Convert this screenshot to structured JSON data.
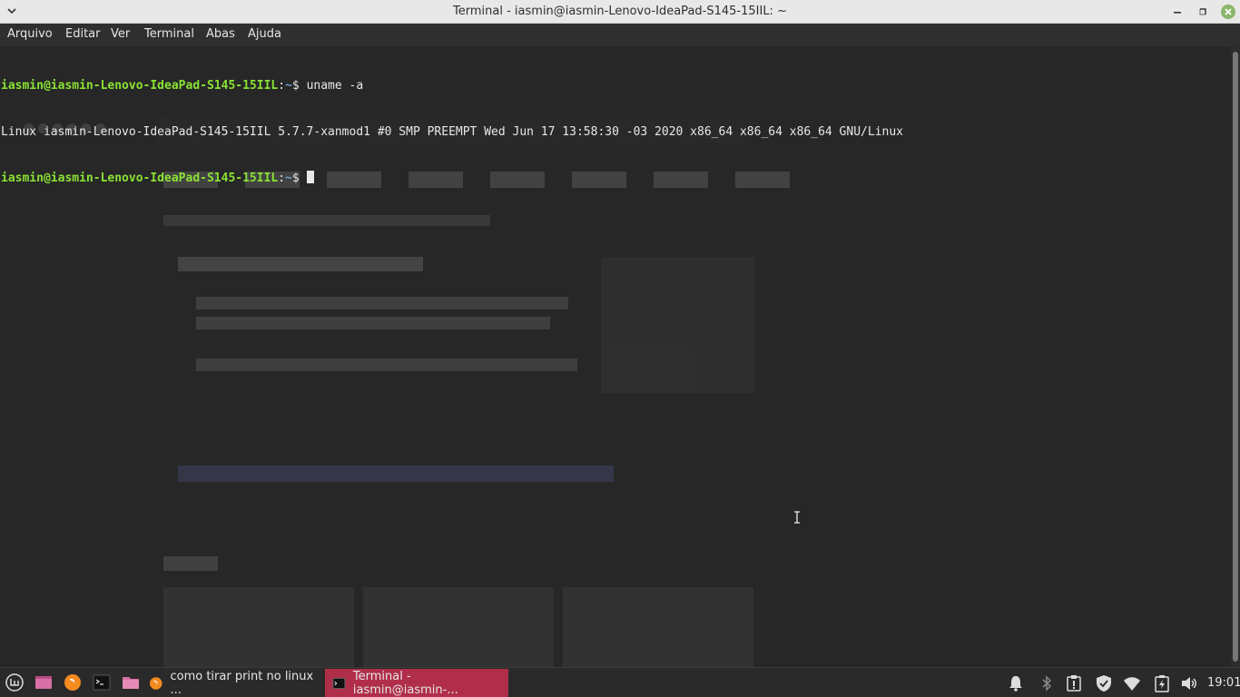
{
  "window": {
    "title": "Terminal - iasmin@iasmin-Lenovo-IdeaPad-S145-15IIL: ~"
  },
  "menu": [
    "Arquivo",
    "Editar",
    "Ver",
    "Terminal",
    "Abas",
    "Ajuda"
  ],
  "terminal": {
    "lines": [
      {
        "prompt": "iasmin@iasmin-Lenovo-IdeaPad-S145-15IIL",
        "path": "~",
        "command": "uname -a"
      },
      {
        "output": "Linux iasmin-Lenovo-IdeaPad-S145-15IIL 5.7.7-xanmod1 #0 SMP PREEMPT Wed Jun 17 13:58:30 -03 2020 x86_64 x86_64 x86_64 GNU/Linux"
      },
      {
        "prompt": "iasmin@iasmin-Lenovo-IdeaPad-S145-15IIL",
        "path": "~",
        "command": ""
      }
    ]
  },
  "taskbar": {
    "tasks": [
      {
        "label": "como tirar print no linux ...",
        "icon": "firefox-icon",
        "active": false
      },
      {
        "label": "Terminal - iasmin@iasmin-...",
        "icon": "terminal-icon",
        "active": true
      }
    ],
    "clock": "19:01"
  },
  "colors": {
    "prompt": "#8ae234",
    "path": "#729fcf",
    "active_task": "#b02e4a",
    "terminal_bg": "#272727"
  }
}
